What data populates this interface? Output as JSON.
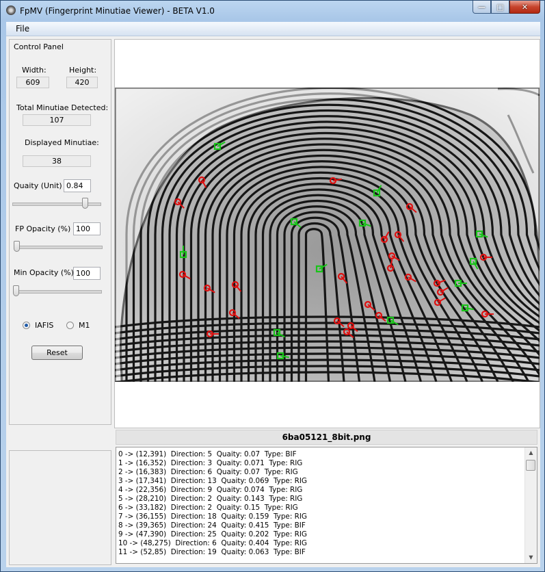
{
  "window": {
    "title": "FpMV (Fingerprint Minutiae Viewer) - BETA V1.0",
    "min": "—",
    "max": "□",
    "close": "✕"
  },
  "menu": {
    "file": "File"
  },
  "panel": {
    "title": "Control Panel",
    "width_label": "Width:",
    "width_value": "609",
    "height_label": "Height:",
    "height_value": "420",
    "total_label": "Total Minutiae Detected:",
    "total_value": "107",
    "displayed_label": "Displayed Minutiae:",
    "displayed_value": "38",
    "quality_label": "Quaity (Unit) >",
    "quality_value": "0.84",
    "quality_slider": 0.84,
    "fp_opacity_label": "FP Opacity (%)  >",
    "fp_opacity_value": "100",
    "fp_opacity_slider": 0.0,
    "min_opacity_label": "Min Opacity (%) >",
    "min_opacity_value": "100",
    "min_opacity_slider": 0.0,
    "radio_iafis": "IAFIS",
    "radio_m1": "M1",
    "selected": "IAFIS",
    "reset": "Reset"
  },
  "image": {
    "filename": "6ba05121_8bit.png"
  },
  "list": [
    "0 -> (12,391)  Direction: 5  Quaity: 0.07  Type: BIF",
    "1 -> (16,352)  Direction: 3  Quaity: 0.071  Type: RIG",
    "2 -> (16,383)  Direction: 6  Quaity: 0.07  Type: RIG",
    "3 -> (17,341)  Direction: 13  Quaity: 0.069  Type: RIG",
    "4 -> (22,356)  Direction: 9  Quaity: 0.074  Type: RIG",
    "5 -> (28,210)  Direction: 2  Quaity: 0.143  Type: RIG",
    "6 -> (33,182)  Direction: 2  Quaity: 0.15  Type: RIG",
    "7 -> (36,155)  Direction: 18  Quaity: 0.159  Type: RIG",
    "8 -> (39,365)  Direction: 24  Quaity: 0.415  Type: BIF",
    "9 -> (47,390)  Direction: 25  Quaity: 0.202  Type: RIG",
    "10 -> (48,275)  Direction: 6  Quaity: 0.404  Type: RIG",
    "11 -> (52,85)  Direction: 19  Quaity: 0.063  Type: BIF"
  ],
  "colors": {
    "ridge_ending": "#e01010",
    "bifurcation": "#19c419"
  },
  "icons": {
    "app": "fingerprint-app-icon",
    "radio": "radio-button"
  }
}
